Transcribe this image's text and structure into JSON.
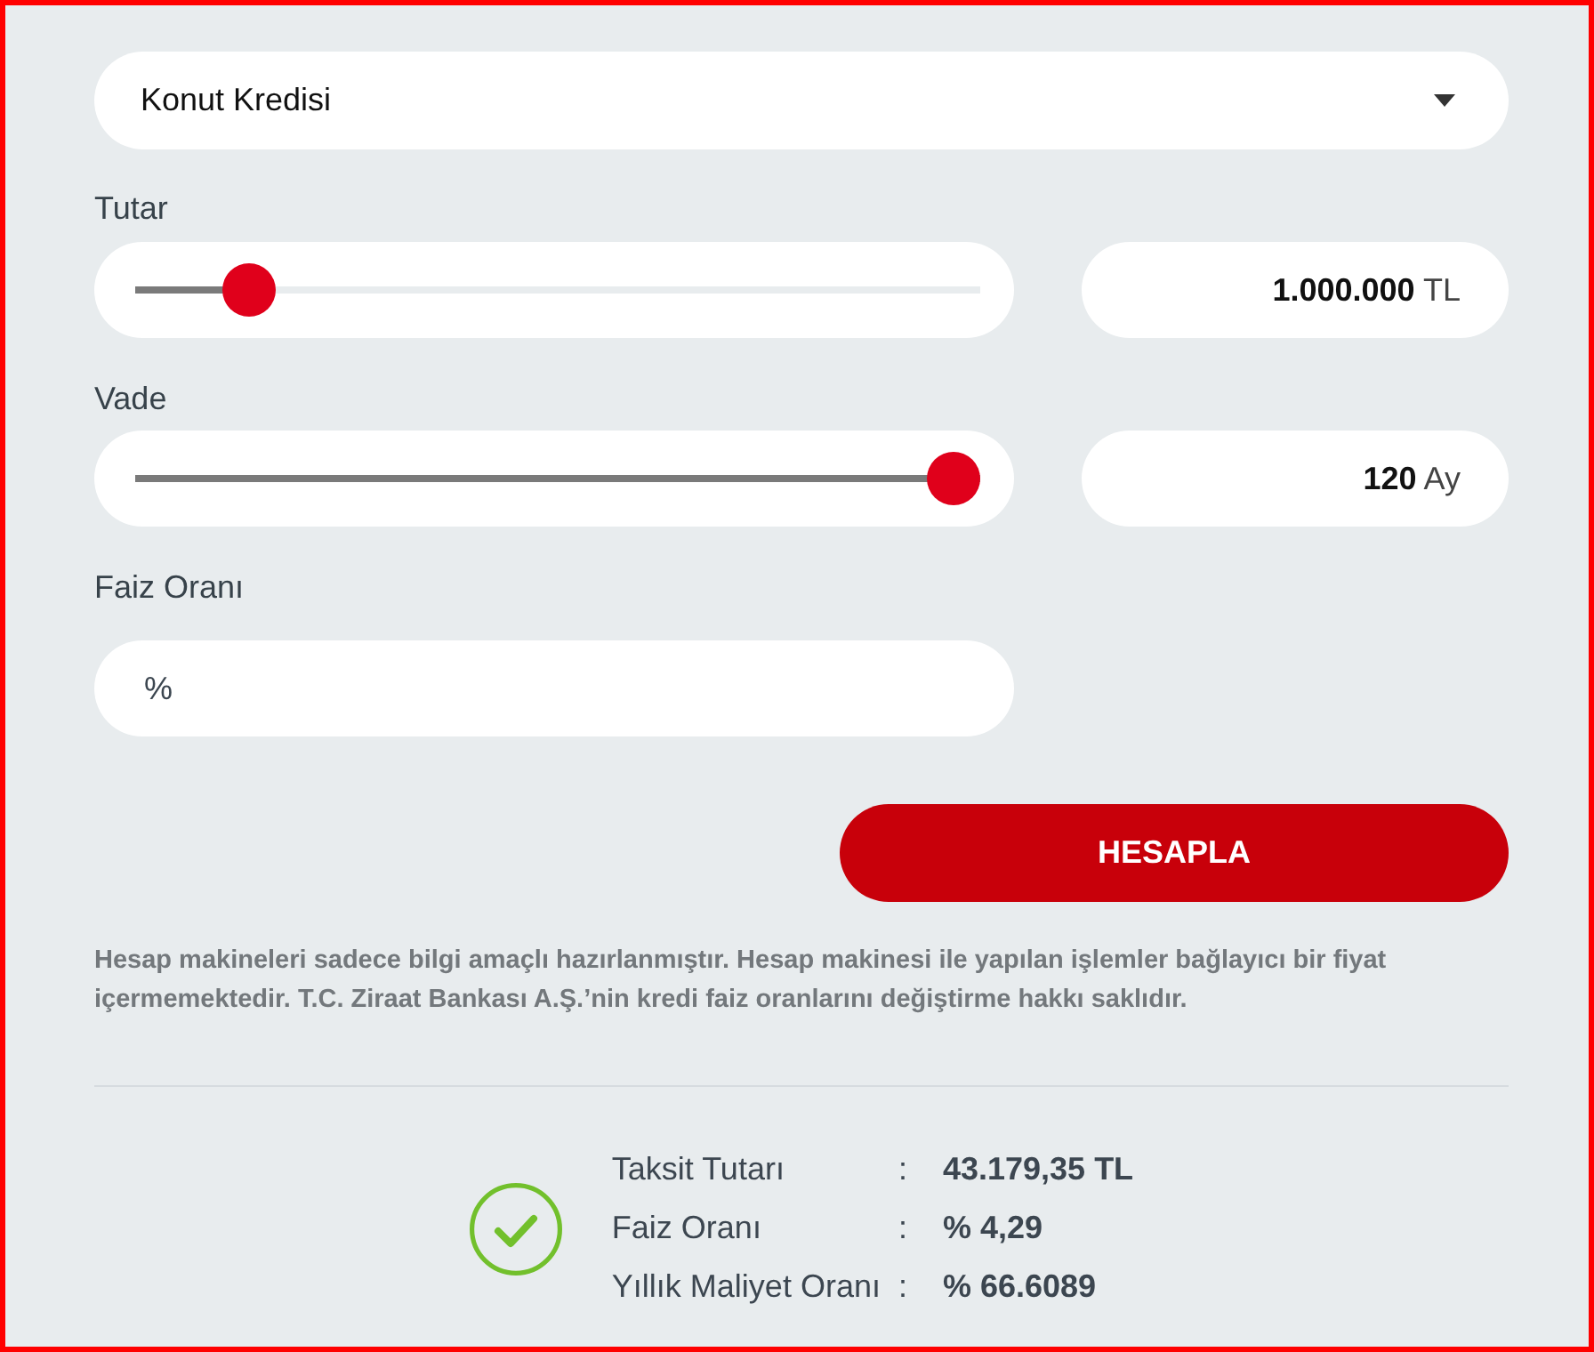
{
  "loan_type": {
    "value": "Konut Kredisi"
  },
  "amount": {
    "label": "Tutar",
    "level": 0.11,
    "value": "**1.000.000** TL"
  },
  "term": {
    "label": "Vade",
    "level": 1,
    "value": "**120** Ay"
  },
  "interest_rate": {
    "label": "Faiz Oranı",
    "placeholder": "%"
  },
  "calculate_button": {
    "label": "HESAPLA"
  },
  "disclaimer": "Hesap makineleri sadece bilgi amaçlı hazırlanmıştır. Hesap makinesi ile yapılan işlemler bağlayıcı bir fiyat içermemektedir. T.C. Ziraat Bankası A.Ş.’nin kredi faiz oranlarını değiştirme hakkı saklıdır.",
  "results": [
    {
      "label": "Taksit Tutarı",
      "separator": ":",
      "value": "43.179,35 TL"
    },
    {
      "label": "Faiz Oranı",
      "separator": ":",
      "value": "% 4,29"
    },
    {
      "label": "Yıllık Maliyet Oranı",
      "separator": ":",
      "value": "% 66.6089"
    }
  ]
}
